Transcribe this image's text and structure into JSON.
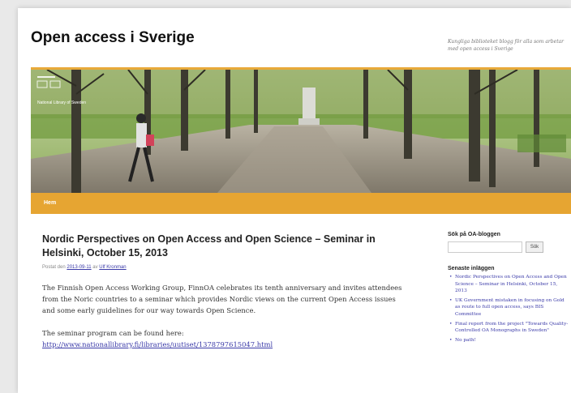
{
  "site": {
    "title": "Open access i Sverige",
    "description": "Kungliga biblioteket blogg för alla som arbetar med open access i Sverige",
    "banner_logo_text": "National Library of Sweden"
  },
  "nav": {
    "items": [
      {
        "label": "Hem"
      }
    ]
  },
  "post": {
    "title": "Nordic Perspectives on Open Access and Open Science – Seminar in Helsinki, October 15, 2013",
    "posted_on_label": "Postat den",
    "date": "2013-09-11",
    "by_label": "av",
    "author": "Ulf Kronman",
    "paragraph1": "The Finnish Open Access Working Group, FinnOA  celebrates its tenth anniversary and invites attendees from the Noric countries to a seminar which provides Nordic views on the current Open Access issues and some early guidelines for our way towards Open Science.",
    "paragraph2_prefix": "The seminar program can be found here:",
    "link": "http://www.nationallibrary.fi/libraries/uutiset/1378797615047.html"
  },
  "sidebar": {
    "search_heading": "Sök på OA-bloggen",
    "search_placeholder": "",
    "search_button": "Sök",
    "recent_heading": "Senaste inläggen",
    "recent_posts": [
      {
        "title": "Nordic Perspectives on Open Access and Open Science – Seminar in Helsinki, October 15, 2013"
      },
      {
        "title": "UK Government mistaken in focusing on Gold as route to full open access, says BIS Committee"
      },
      {
        "title": "Final report from the project \"Towards Quality-Controlled OA Monographs in Sweden\""
      },
      {
        "title": "No path!"
      }
    ]
  },
  "colors": {
    "accent": "#e6a532",
    "link": "#3a3aa8"
  }
}
